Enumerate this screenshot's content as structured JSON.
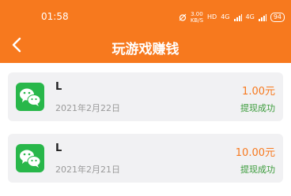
{
  "status_bar": {
    "time": "01:58",
    "speed_value": "3.00",
    "speed_unit": "KB/S",
    "hd": "HD",
    "net1": "4G",
    "net2": "4G",
    "battery": "94"
  },
  "header": {
    "title": "玩游戏赚钱"
  },
  "records": [
    {
      "name": "L",
      "date": "2021年2月22日",
      "amount": "1.00元",
      "status": "提现成功"
    },
    {
      "name": "L",
      "date": "2021年2月21日",
      "amount": "10.00元",
      "status": "提现成功"
    }
  ],
  "colors": {
    "header_bg": "#f7791e",
    "amount": "#f7791e",
    "status_success": "#3a9b3a",
    "wechat_green": "#28b74a",
    "card_bg": "#f1f1f3"
  },
  "icons": {
    "back": "chevron-left-icon",
    "payment": "wechat-icon"
  }
}
